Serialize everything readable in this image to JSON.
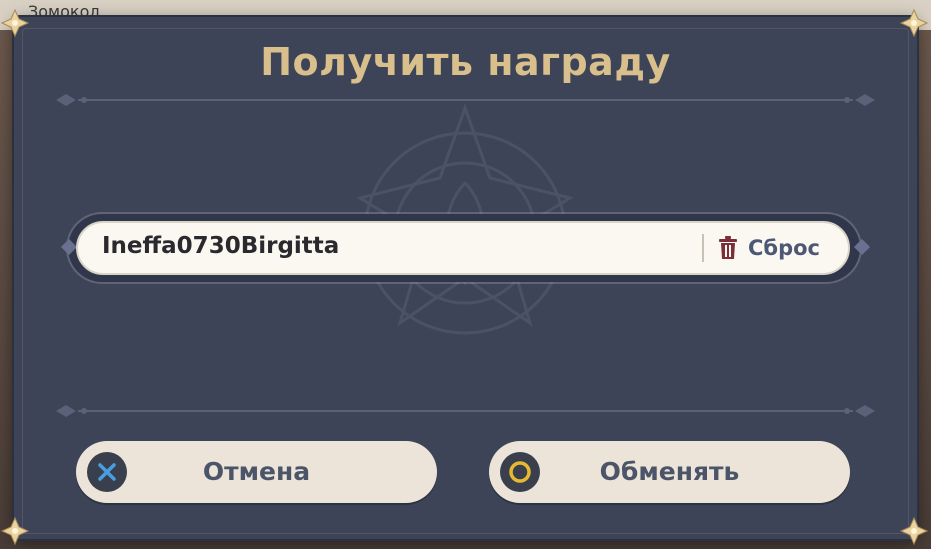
{
  "background": {
    "partial_text": "Зомокол"
  },
  "dialog": {
    "title": "Получить награду",
    "input": {
      "value": "Ineffa0730Birgitta",
      "reset_label": "Сброс",
      "reset_icon": "trash-icon"
    },
    "buttons": {
      "cancel_label": "Отмена",
      "cancel_icon": "cross-icon",
      "confirm_label": "Обменять",
      "confirm_icon": "circle-icon"
    }
  },
  "colors": {
    "panel": "#3d4458",
    "title_gold": "#d8bf8c",
    "button_bg": "#ece4d8",
    "button_text": "#4b5468",
    "cross_blue": "#4a9ee0",
    "circle_yellow": "#e8b830",
    "trash_red": "#7a2f3a"
  }
}
